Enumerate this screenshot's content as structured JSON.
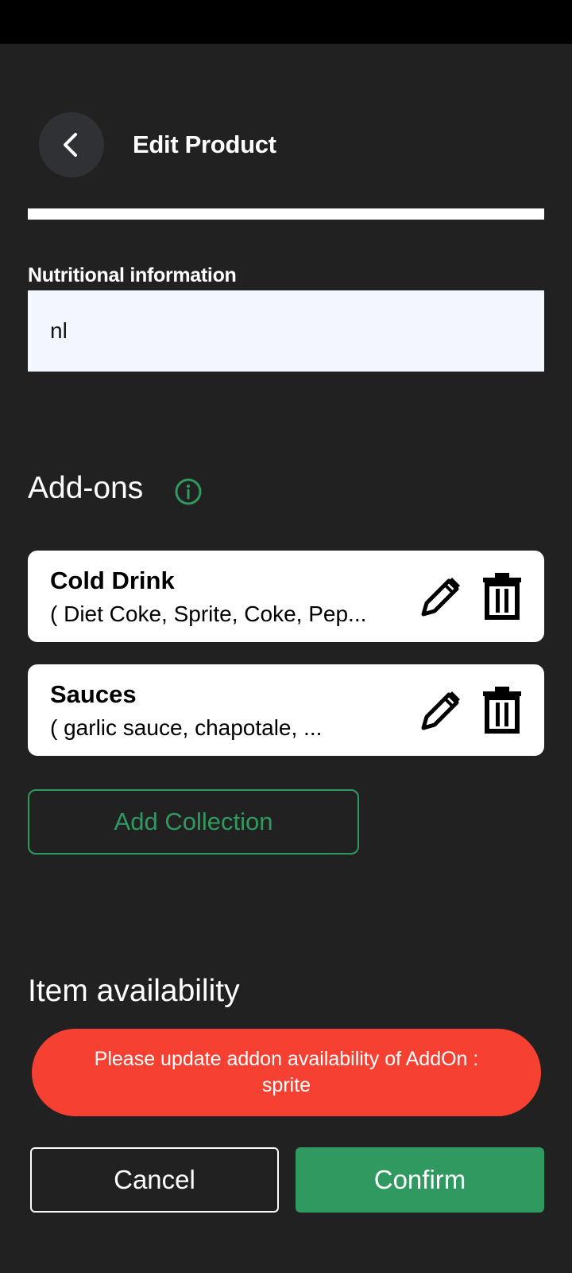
{
  "header": {
    "title": "Edit Product",
    "back_icon": "chevron-left-icon"
  },
  "nutrition": {
    "label": "Nutritional information",
    "value": "nl"
  },
  "addons": {
    "title": "Add-ons",
    "info_icon": "info-icon",
    "items": [
      {
        "name": "Cold Drink",
        "items": "( Diet Coke, Sprite, Coke, Pep..."
      },
      {
        "name": "Sauces",
        "items": "( garlic sauce, chapotale, ..."
      }
    ],
    "add_collection_label": "Add Collection"
  },
  "availability": {
    "title": "Item availability"
  },
  "toast": {
    "line1": "Please update addon availability of AddOn  :",
    "line2": "sprite"
  },
  "footer": {
    "cancel_label": "Cancel",
    "confirm_label": "Confirm"
  },
  "colors": {
    "background": "#212121",
    "accent": "#2f9960",
    "toast": "#f64132",
    "field": "#f4f6fe"
  }
}
